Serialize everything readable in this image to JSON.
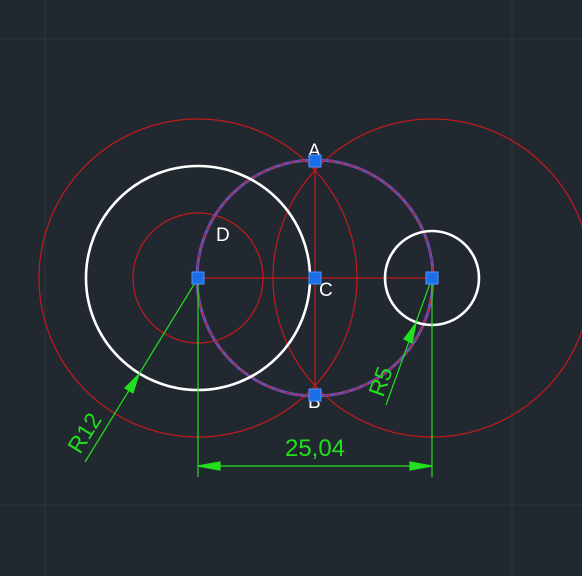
{
  "colors": {
    "background": "#212830",
    "grid": "#2b333d",
    "construction": "#c41a1a",
    "geometry": "#ffffff",
    "dimension": "#22e01e",
    "selected": "#6a4fb0",
    "grip": "#1a6fe6"
  },
  "points": {
    "A": "A",
    "B": "B",
    "C": "C",
    "D": "D"
  },
  "dimensions": {
    "linear": "25,04",
    "radius_large": "R12",
    "radius_small": "R5"
  }
}
